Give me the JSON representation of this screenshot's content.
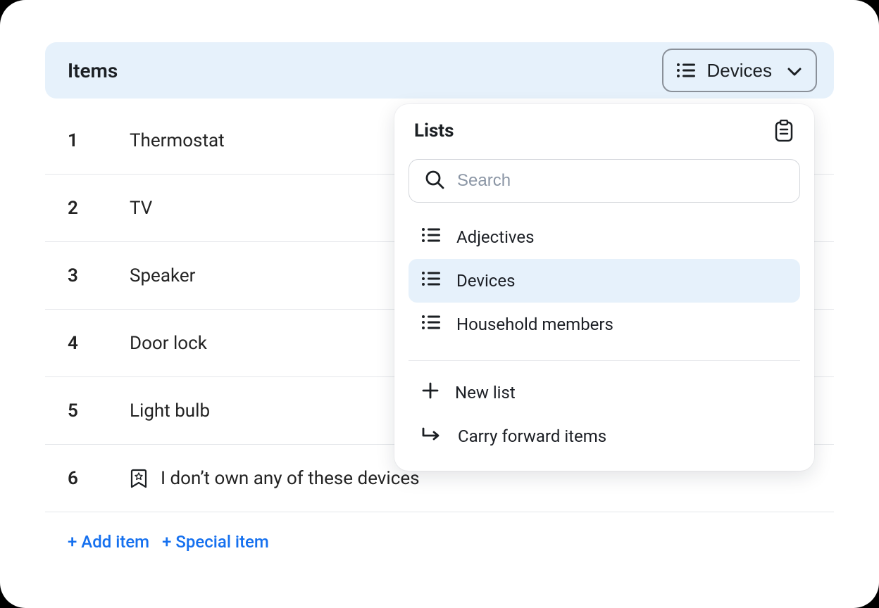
{
  "header": {
    "title": "Items",
    "dropdown_label": "Devices"
  },
  "items": [
    {
      "num": "1",
      "label": "Thermostat",
      "special": false
    },
    {
      "num": "2",
      "label": "TV",
      "special": false
    },
    {
      "num": "3",
      "label": "Speaker",
      "special": false
    },
    {
      "num": "4",
      "label": "Door lock",
      "special": false
    },
    {
      "num": "5",
      "label": "Light bulb",
      "special": false
    },
    {
      "num": "6",
      "label": "I don’t own any of these devices",
      "special": true
    }
  ],
  "actions": {
    "add_item": "+ Add item",
    "special_item": "+ Special item"
  },
  "popover": {
    "title": "Lists",
    "search_placeholder": "Search",
    "lists": [
      {
        "label": "Adjectives",
        "selected": false
      },
      {
        "label": "Devices",
        "selected": true
      },
      {
        "label": "Household members",
        "selected": false
      }
    ],
    "new_list": "New list",
    "carry_forward": "Carry forward items"
  }
}
